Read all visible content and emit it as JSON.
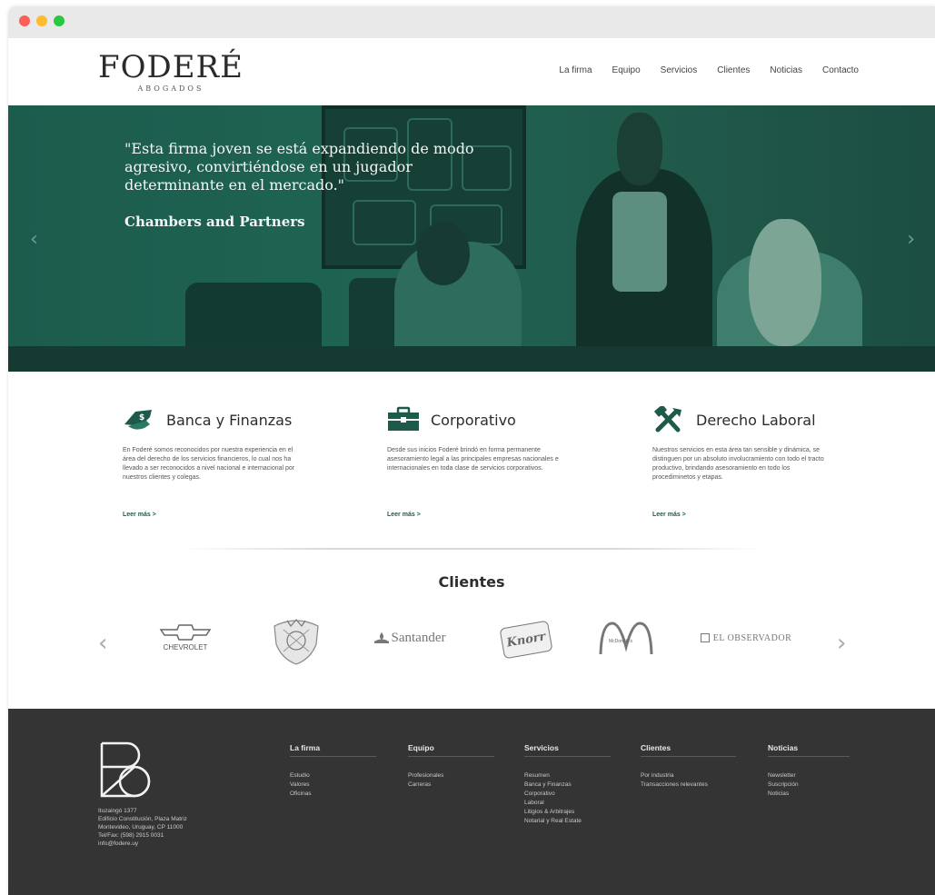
{
  "header": {
    "logo": "FODERÉ",
    "logo_sub": "ABOGADOS",
    "nav": [
      "La firma",
      "Equipo",
      "Servicios",
      "Clientes",
      "Noticias",
      "Contacto"
    ]
  },
  "hero": {
    "quote": "\"Esta firma joven se está expandiendo de modo agresivo, convirtiéndose en un jugador determinante en el mercado.\"",
    "author": "Chambers and Partners",
    "prev_arrow": "‹",
    "next_arrow": "›"
  },
  "services": [
    {
      "icon": "money-icon",
      "title": "Banca y Finanzas",
      "text": "En Foderé somos reconocidos por nuestra experiencia en el área del derecho de los servicios financieros, lo cual nos ha llevado a ser reconocidos a nivel nacional e internacional por nuestros clientes y colegas.",
      "link": "Leer más >"
    },
    {
      "icon": "briefcase-icon",
      "title": "Corporativo",
      "text": "Desde sus inicios Foderé brindó en forma permanente asesoramiento legal a las principales empresas nacionales e internacionales en toda clase de servicios corporativos.",
      "link": "Leer más >"
    },
    {
      "icon": "tools-icon",
      "title": "Derecho Laboral",
      "text": "Nuestros servicios en esta área tan sensible y dinámica, se distinguen por un absoluto involucramiento con todo el tracto productivo, brindando asesoramiento en todo los procediminetos y etapas.",
      "link": "Leer más >"
    }
  ],
  "clients": {
    "title": "Clientes",
    "prev_arrow": "‹",
    "next_arrow": "›",
    "logos": [
      "CHEVROLET",
      "Santander",
      "Knorr",
      "McDonald's",
      "EL OBSERVADOR"
    ]
  },
  "footer": {
    "address": [
      "Ituzaingó 1377",
      "Edificio Constitución, Plaza Matriz",
      "Montevideo, Uruguay, CP 11000",
      "Tel/Fax: (598) 2915 0031",
      "info@fodere.uy"
    ],
    "columns": [
      {
        "title": "La firma",
        "items": [
          "Estudio",
          "Valores",
          "Oficinas"
        ]
      },
      {
        "title": "Equipo",
        "items": [
          "Profesionales",
          "Carreras"
        ]
      },
      {
        "title": "Servicios",
        "items": [
          "Resumen",
          "Banca y Finanzas",
          "Corporativo",
          "Laboral",
          "Litigios & Arbitrajes",
          "Notarial y Real Estate"
        ]
      },
      {
        "title": "Clientes",
        "items": [
          "Por industria",
          "Transacciones relevantes"
        ]
      },
      {
        "title": "Noticias",
        "items": [
          "Newsletter",
          "Suscripción",
          "Noticias"
        ]
      }
    ]
  },
  "colors": {
    "brand_green": "#1d5a4c",
    "footer_bg": "#343434"
  }
}
